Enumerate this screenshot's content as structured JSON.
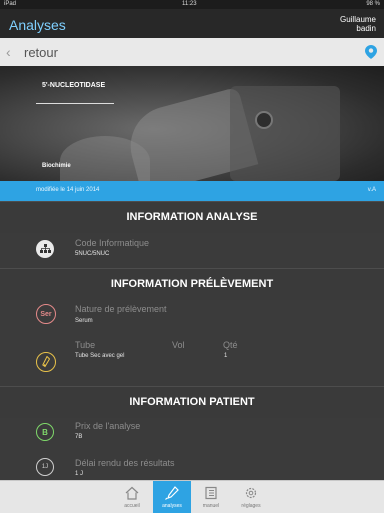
{
  "status": {
    "device": "iPad",
    "time": "11:23",
    "battery": "98 %"
  },
  "header": {
    "title": "Analyses",
    "user_first": "Guillaume",
    "user_last": "badin"
  },
  "nav": {
    "back_label": "retour"
  },
  "hero": {
    "title": "5'-NUCLEOTIDASE",
    "category": "Biochimie"
  },
  "meta": {
    "modified": "modifiée le 14 juin 2014",
    "version": "v.A"
  },
  "sections": {
    "analyse": {
      "title": "INFORMATION ANALYSE",
      "code_label": "Code Informatique",
      "code_value": "5NUC/5NUC"
    },
    "prelevement": {
      "title": "INFORMATION PRÉLÈVEMENT",
      "nature_icon": "Ser",
      "nature_label": "Nature de prélèvement",
      "nature_value": "Serum",
      "col_tube": "Tube",
      "col_vol": "Vol",
      "col_qte": "Qté",
      "tube_value": "Tube Sec avec gel",
      "qte_value": "1"
    },
    "patient": {
      "title": "INFORMATION PATIENT",
      "prix_icon": "B",
      "prix_label": "Prix de l'analyse",
      "prix_value": "7B",
      "delai_icon": "1J",
      "delai_label": "Délai rendu des résultats",
      "delai_value": "1 J"
    }
  },
  "tabs": [
    {
      "label": "accueil",
      "icon": "home-icon"
    },
    {
      "label": "analyses",
      "icon": "pipette-icon"
    },
    {
      "label": "manuel",
      "icon": "book-icon"
    },
    {
      "label": "réglages",
      "icon": "gear-icon"
    }
  ],
  "colors": {
    "accent": "#2ea3e3",
    "header_bg": "#282828",
    "body_bg": "#3b3b3b",
    "nature_circle": "#e58a8a",
    "prix_circle": "#7fd86a"
  }
}
